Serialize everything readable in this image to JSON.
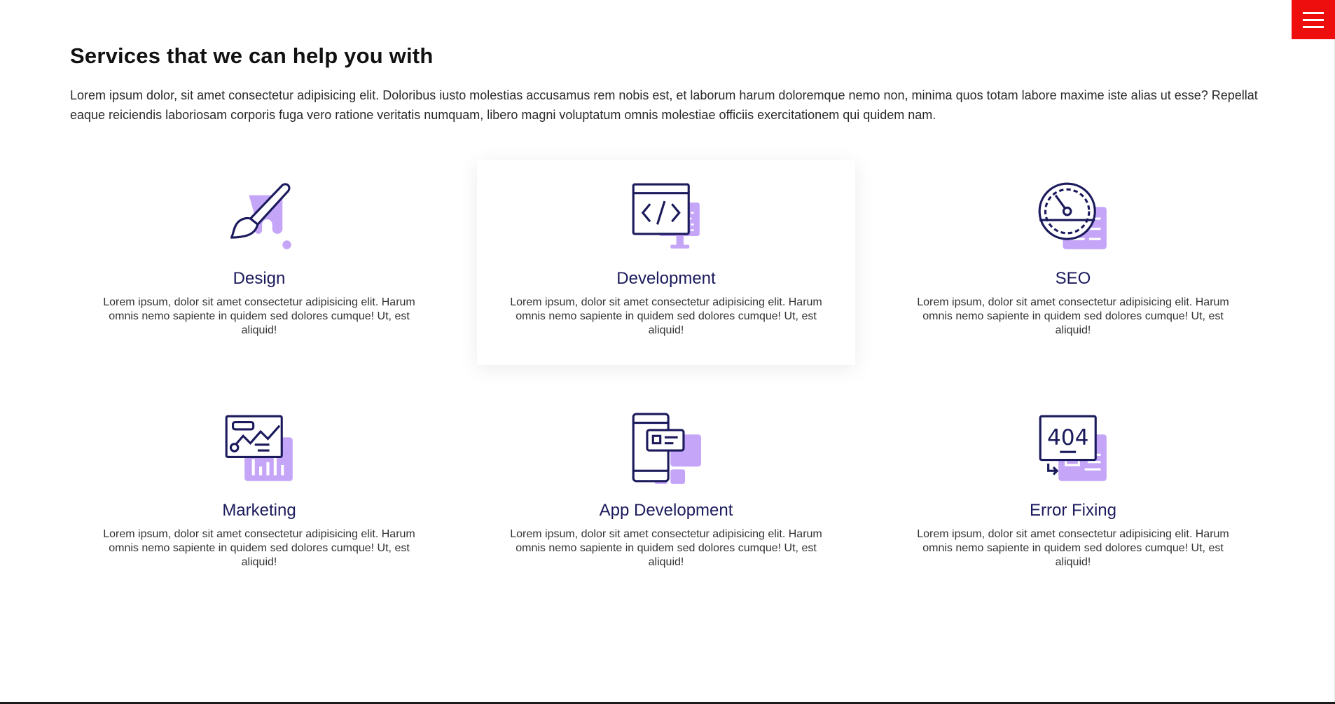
{
  "section": {
    "title": "Services that we can help you with",
    "intro": "Lorem ipsum dolor, sit amet consectetur adipisicing elit. Doloribus iusto molestias accusamus rem nobis est, et laborum harum doloremque nemo non, minima quos totam labore maxime iste alias ut esse? Repellat eaque reiciendis laboriosam corporis fuga vero ratione veritatis numquam, libero magni voluptatum omnis molestiae officiis exercitationem qui quidem nam."
  },
  "menu": {
    "icon": "hamburger-menu-icon"
  },
  "colors": {
    "accent": "#ef0e0e",
    "heading": "#1b1a5c",
    "icon_outline": "#1b1a5c",
    "icon_fill": "#c4a5f7"
  },
  "services": [
    {
      "title": "Design",
      "icon": "paintbrush-icon",
      "description": "Lorem ipsum, dolor sit amet consectetur adipisicing elit. Harum omnis nemo sapiente in quidem sed dolores cumque! Ut, est aliquid!"
    },
    {
      "title": "Development",
      "icon": "code-monitor-icon",
      "description": "Lorem ipsum, dolor sit amet consectetur adipisicing elit. Harum omnis nemo sapiente in quidem sed dolores cumque! Ut, est aliquid!"
    },
    {
      "title": "SEO",
      "icon": "speedometer-icon",
      "description": "Lorem ipsum, dolor sit amet consectetur adipisicing elit. Harum omnis nemo sapiente in quidem sed dolores cumque! Ut, est aliquid!"
    },
    {
      "title": "Marketing",
      "icon": "analytics-chart-icon",
      "description": "Lorem ipsum, dolor sit amet consectetur adipisicing elit. Harum omnis nemo sapiente in quidem sed dolores cumque! Ut, est aliquid!"
    },
    {
      "title": "App Development",
      "icon": "mobile-app-icon",
      "description": "Lorem ipsum, dolor sit amet consectetur adipisicing elit. Harum omnis nemo sapiente in quidem sed dolores cumque! Ut, est aliquid!"
    },
    {
      "title": "Error Fixing",
      "icon": "error-404-icon",
      "description": "Lorem ipsum, dolor sit amet consectetur adipisicing elit. Harum omnis nemo sapiente in quidem sed dolores cumque! Ut, est aliquid!"
    }
  ]
}
